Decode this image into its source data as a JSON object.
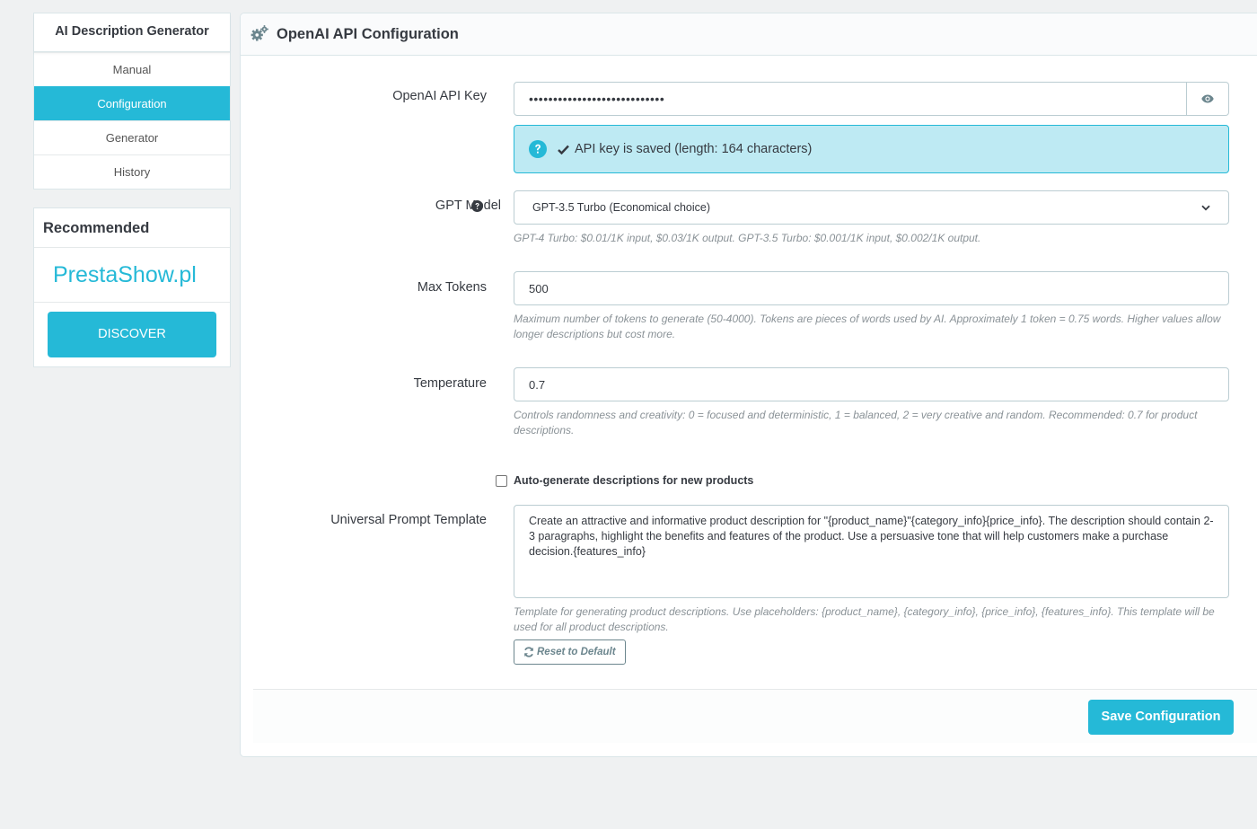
{
  "sidebar": {
    "title": "AI Description Generator",
    "items": [
      {
        "label": "Manual",
        "active": false
      },
      {
        "label": "Configuration",
        "active": true
      },
      {
        "label": "Generator",
        "active": false
      },
      {
        "label": "History",
        "active": false
      }
    ],
    "recommended": {
      "title": "Recommended",
      "brand": "PrestaShow.pl",
      "button_label": "DISCOVER"
    }
  },
  "panel": {
    "title": "OpenAI API Configuration",
    "heading_icon": "cogs-icon"
  },
  "form": {
    "api_key": {
      "label": "OpenAI API Key",
      "value": "••••••••••••••••••••••••••••",
      "toggle_icon": "eye-icon",
      "alert": "API key is saved (length: 164 characters)"
    },
    "gpt_model": {
      "label": "GPT Model",
      "selected": "GPT-3.5 Turbo (Economical choice)",
      "help": "GPT-4 Turbo: $0.01/1K input, $0.03/1K output. GPT-3.5 Turbo: $0.001/1K input, $0.002/1K output."
    },
    "max_tokens": {
      "label": "Max Tokens",
      "value": "500",
      "help": "Maximum number of tokens to generate (50-4000). Tokens are pieces of words used by AI. Approximately 1 token = 0.75 words. Higher values allow longer descriptions but cost more."
    },
    "temperature": {
      "label": "Temperature",
      "value": "0.7",
      "help": "Controls randomness and creativity: 0 = focused and deterministic, 1 = balanced, 2 = very creative and random. Recommended: 0.7 for product descriptions."
    },
    "auto_generate": {
      "label": "Auto-generate descriptions for new products",
      "checked": false
    },
    "prompt_template": {
      "label": "Universal Prompt Template",
      "value": "Create an attractive and informative product description for \"{product_name}\"{category_info}{price_info}. The description should contain 2-3 paragraphs, highlight the benefits and features of the product. Use a persuasive tone that will help customers make a purchase decision.{features_info}",
      "help": "Template for generating product descriptions. Use placeholders: {product_name}, {category_info}, {price_info}, {features_info}. This template will be used for all product descriptions.",
      "reset_label": "Reset to Default"
    }
  },
  "footer": {
    "save_label": "Save Configuration"
  },
  "colors": {
    "accent": "#25b9d7",
    "alert_bg": "#beeaf3",
    "background": "#eff1f2"
  }
}
